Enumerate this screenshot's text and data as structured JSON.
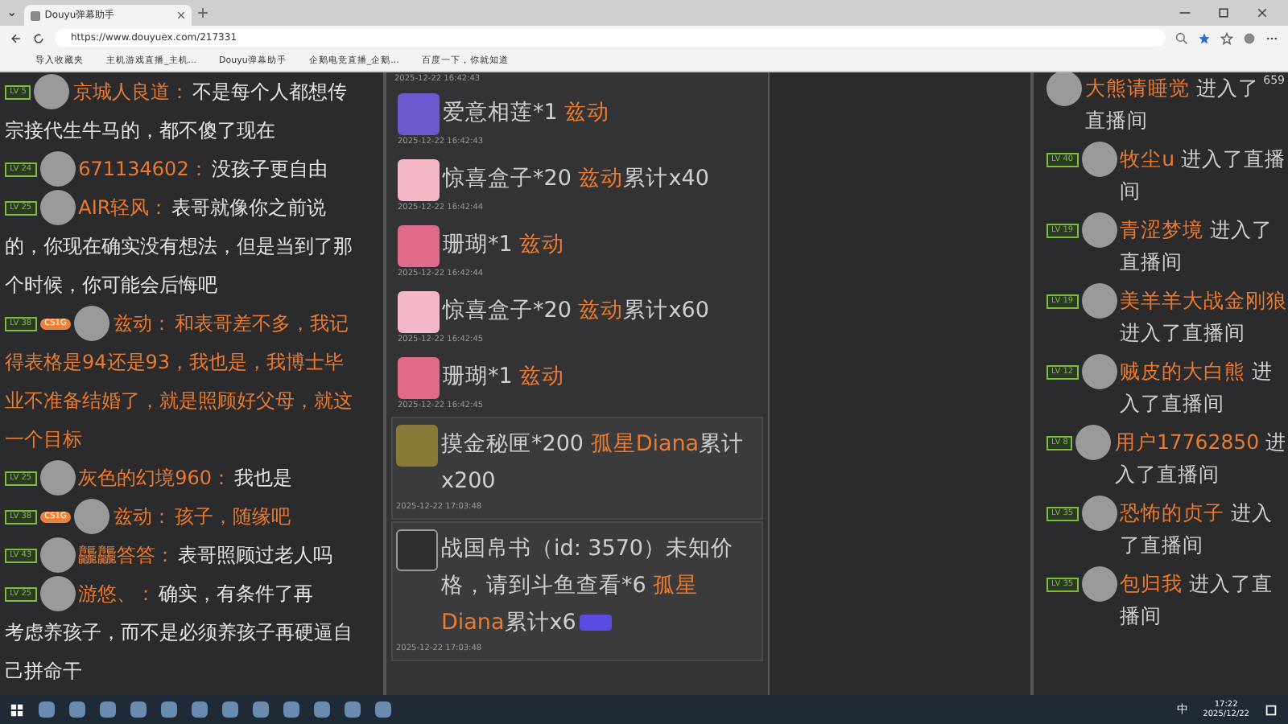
{
  "browser": {
    "tab_list": "⌄",
    "tab_title": "Douyu弹幕助手",
    "url": "https://www.douyuex.com/217331",
    "bookmarks": [
      "导入收藏夹",
      "主机游戏直播_主机...",
      "Douyu弹幕助手",
      "企鹅电竞直播_企鹅...",
      "百度一下，你就知道"
    ]
  },
  "chat": {
    "messages": [
      {
        "level": "LV 5",
        "user": "京城人良道：",
        "lines": [
          "不是每个人都想传",
          "宗接代生牛马的，都不傻了现在"
        ],
        "highlight": false
      },
      {
        "level": "LV 24",
        "user": "671134602：",
        "lines": [
          "没孩子更自由"
        ],
        "highlight": false
      },
      {
        "level": "LV 25",
        "user": "AIR轻风：",
        "lines": [
          "表哥就像你之前说",
          "的，你现在确实没有想法，但是当到了那",
          "个时候，你可能会后悔吧"
        ],
        "highlight": false
      },
      {
        "level": "LV 38",
        "badge": "CS1G",
        "user": "兹动：",
        "lines": [
          "和表哥差不多，我记",
          "得表格是94还是93，我也是，我博士毕",
          "业不准备结婚了，就是照顾好父母，就这",
          "一个目标"
        ],
        "highlight": true
      },
      {
        "level": "LV 25",
        "user": "灰色的幻境960：",
        "lines": [
          "我也是"
        ],
        "highlight": false
      },
      {
        "level": "LV 38",
        "badge": "CS1G",
        "user": "兹动：",
        "lines": [
          "孩子，随缘吧"
        ],
        "highlight": true
      },
      {
        "level": "LV 43",
        "user": "龘龘答答：",
        "lines": [
          "表哥照顾过老人吗"
        ],
        "highlight": false
      },
      {
        "level": "LV 25",
        "user": "游悠、：",
        "lines": [
          "确实，有条件了再",
          "考虑养孩子，而不是必须养孩子再硬逼自",
          "己拼命干"
        ],
        "highlight": false
      }
    ]
  },
  "gifts": {
    "top_time": "2025-12-22 16:42:43",
    "items": [
      {
        "kind": "lotus",
        "gift": "爱意相莲*1",
        "user": "兹动",
        "time": "2025-12-22 16:42:43",
        "boxed": false,
        "tag": false
      },
      {
        "kind": "box",
        "gift": "惊喜盒子*20",
        "user": "兹动",
        "total": "累计x40",
        "time": "2025-12-22 16:42:44",
        "boxed": false,
        "tag": false
      },
      {
        "kind": "coral",
        "gift": "珊瑚*1",
        "user": "兹动",
        "time": "2025-12-22 16:42:44",
        "boxed": false,
        "tag": false
      },
      {
        "kind": "box",
        "gift": "惊喜盒子*20",
        "user": "兹动",
        "total": "累计x60",
        "time": "2025-12-22 16:42:45",
        "boxed": false,
        "tag": false
      },
      {
        "kind": "coral",
        "gift": "珊瑚*1",
        "user": "兹动",
        "time": "2025-12-22 16:42:45",
        "boxed": false,
        "tag": false
      },
      {
        "kind": "gold",
        "gift": "摸金秘匣*200",
        "user": "孤星Diana",
        "total": "累计x200",
        "time": "2025-12-22 17:03:48",
        "boxed": true,
        "tag": false
      },
      {
        "kind": "missing",
        "gift": "战国帛书（id: 3570）未知价格，请到斗鱼查看*6",
        "user": "孤星Diana",
        "total": "累计x6",
        "time": "2025-12-22 17:03:48",
        "boxed": true,
        "tag": true
      }
    ]
  },
  "entries": {
    "online": "659",
    "items": [
      {
        "user": "大熊请睡觉",
        "text": "进入了直播间"
      },
      {
        "level": "LV 40",
        "user": "牧尘u",
        "text": "进入了直播间"
      },
      {
        "level": "LV 19",
        "user": "青涩梦境",
        "text": "进入了直播间"
      },
      {
        "level": "LV 19",
        "user": "美羊羊大战金刚狼",
        "text": "进入了直播间"
      },
      {
        "level": "LV 12",
        "user": "贼皮的大白熊",
        "text": "进入了直播间"
      },
      {
        "level": "LV 8",
        "user": "用户17762850",
        "text": "进入了直播间"
      },
      {
        "level": "LV 35",
        "user": "恐怖的贞子",
        "text": "进入了直播间"
      },
      {
        "level": "LV 35",
        "user": "包归我",
        "text": "进入了直播间"
      }
    ]
  },
  "taskbar": {
    "ime": "中",
    "time": "17:22",
    "date": "2025/12/22"
  }
}
